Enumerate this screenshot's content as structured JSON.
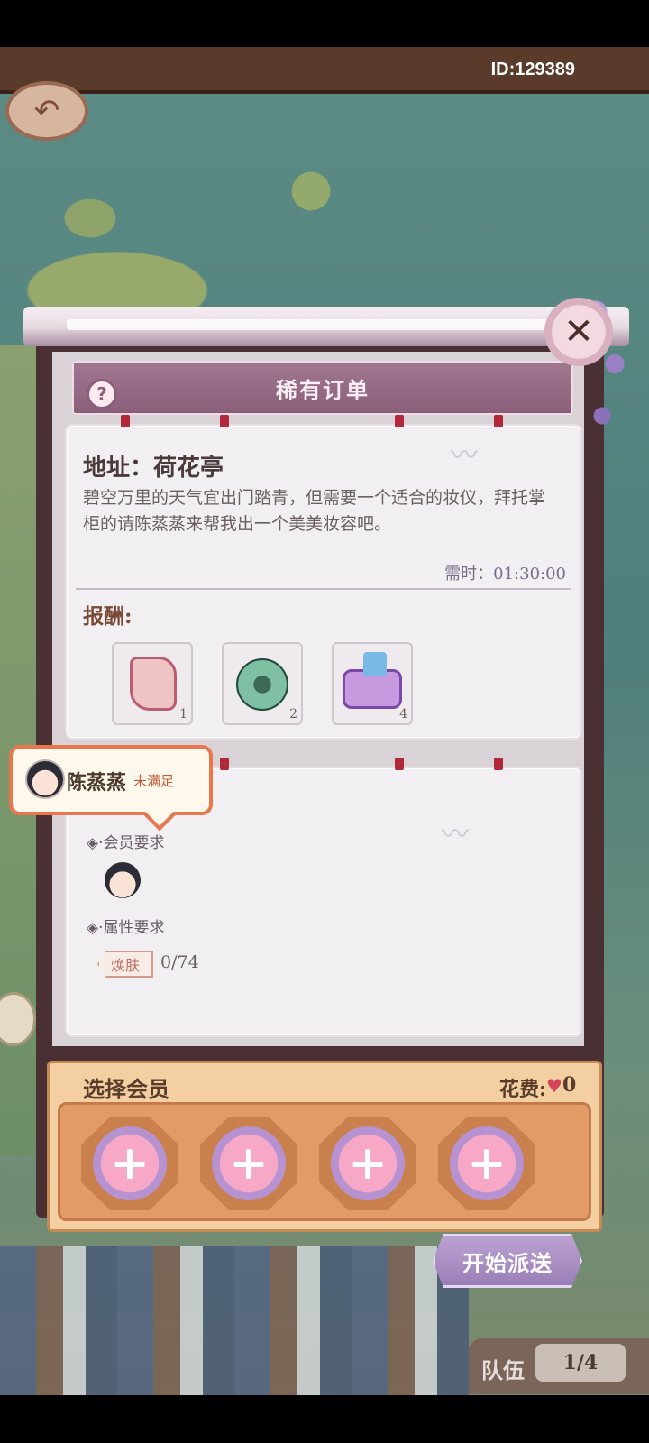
{
  "header": {
    "id_text": "ID:129389"
  },
  "order": {
    "title": "稀有订单",
    "address": "地址：荷花亭",
    "description": "碧空万里的天气宜出门踏青，但需要一个适合的妆仪，拜托掌柜的请陈蒸蒸来帮我出一个美美妆容吧。",
    "time_label": "需时：01:30:00",
    "reward_label": "报酬:",
    "rewards": [
      {
        "icon": "paper-item-icon",
        "count": "1"
      },
      {
        "icon": "jade-item-icon",
        "count": "2"
      },
      {
        "icon": "upgrade-item-icon",
        "count": "4"
      }
    ]
  },
  "member_tip": {
    "name": "陈蒸蒸",
    "status": "未满足"
  },
  "requirements": {
    "member_req_label": "会员要求",
    "attr_req_label": "属性要求",
    "attr_tag": "焕肤",
    "attr_value": "0/74"
  },
  "select": {
    "title": "选择会员",
    "cost_label": "花费:",
    "cost_value": "0",
    "slot_symbol": "+"
  },
  "actions": {
    "start_label": "开始派送"
  },
  "team": {
    "label": "队伍",
    "count": "1/4"
  },
  "colors": {
    "title_bar": "#8a5f7a",
    "select_panel": "#f3cfa2",
    "start_button": "#9a7fb8",
    "warning": "#e9764d"
  }
}
